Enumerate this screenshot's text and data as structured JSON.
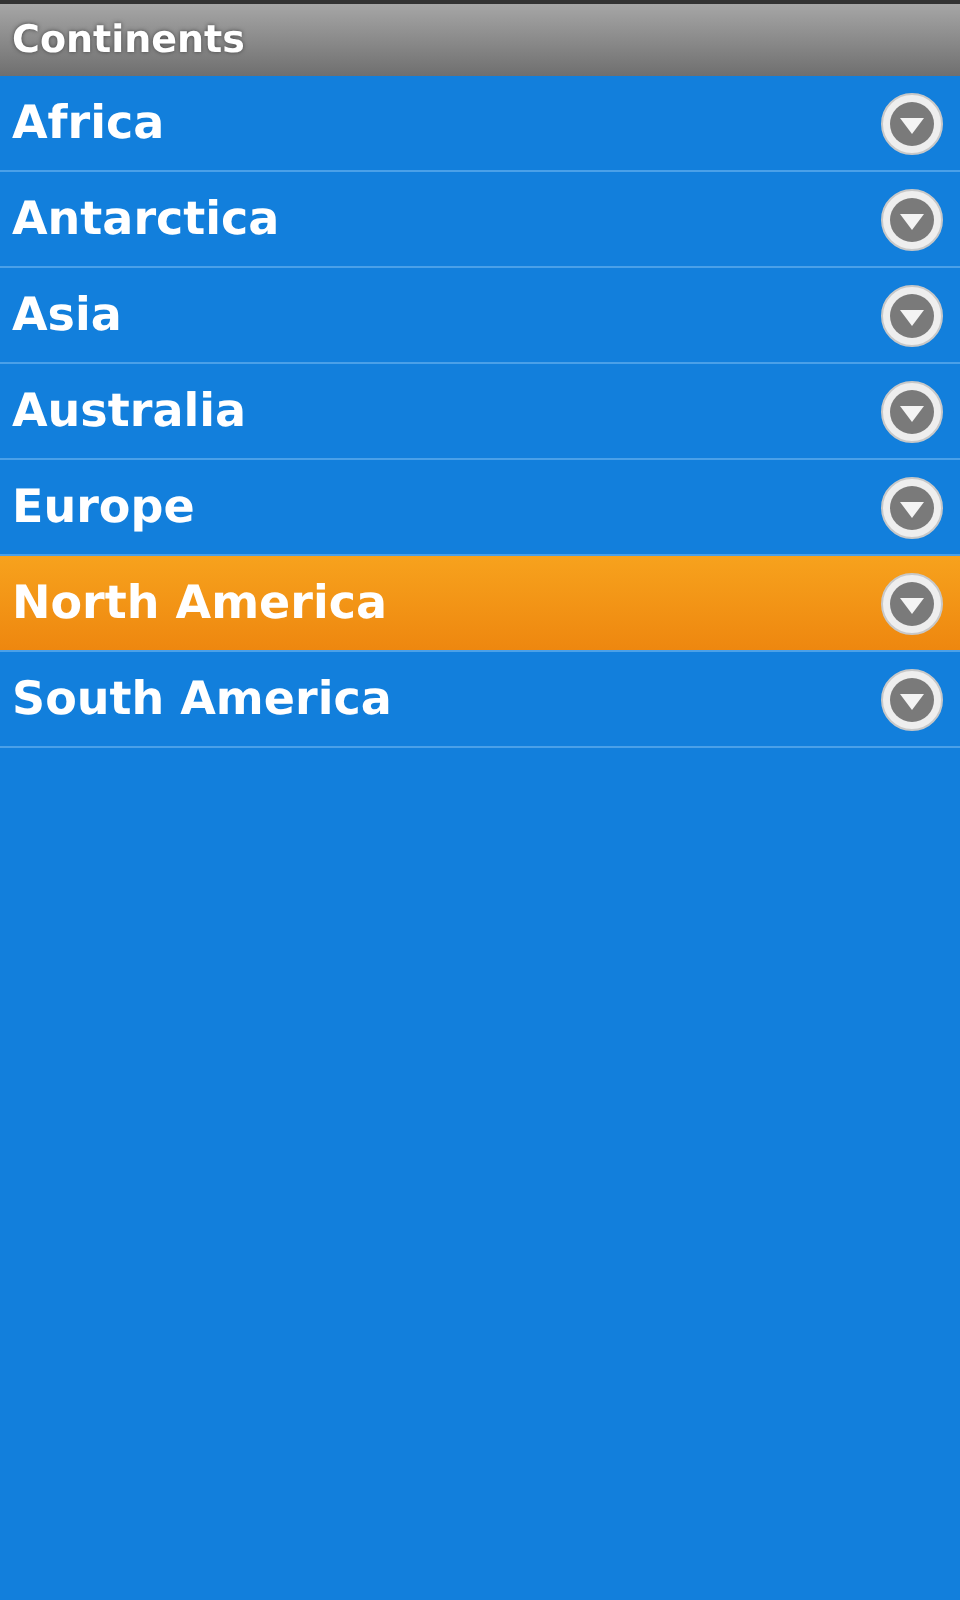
{
  "title": "Continents",
  "items": [
    {
      "label": "Africa",
      "selected": false
    },
    {
      "label": "Antarctica",
      "selected": false
    },
    {
      "label": "Asia",
      "selected": false
    },
    {
      "label": "Australia",
      "selected": false
    },
    {
      "label": "Europe",
      "selected": false
    },
    {
      "label": "North America",
      "selected": true
    },
    {
      "label": "South America",
      "selected": false
    }
  ]
}
